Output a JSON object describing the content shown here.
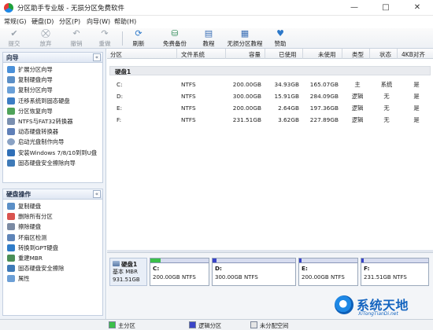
{
  "window": {
    "title": "分区助手专业版 - 无损分区免费软件",
    "controls": [
      "—",
      "□",
      "✕"
    ]
  },
  "menu": [
    "常规(G)",
    "硬盘(D)",
    "分区(P)",
    "向导(W)",
    "帮助(H)"
  ],
  "toolbar": {
    "buttons": [
      {
        "label": "提交",
        "icon": "checkmark-icon",
        "enabled": false
      },
      {
        "label": "放弃",
        "icon": "discard-icon",
        "enabled": false
      },
      {
        "label": "撤销",
        "icon": "undo-icon",
        "enabled": false
      },
      {
        "label": "重做",
        "icon": "redo-icon",
        "enabled": false
      },
      {
        "label": "刷新",
        "icon": "refresh-icon",
        "enabled": true
      },
      {
        "label": "免费备份",
        "icon": "backup-icon",
        "enabled": true
      },
      {
        "label": "教程",
        "icon": "book-icon",
        "enabled": true
      },
      {
        "label": "无损分区教程",
        "icon": "tutorial-icon",
        "enabled": true
      },
      {
        "label": "赞助",
        "icon": "heart-icon",
        "enabled": true
      }
    ]
  },
  "sidebar": {
    "wizard": {
      "title": "向导",
      "collapse": "«",
      "items": [
        "扩展分区向导",
        "复制硬盘向导",
        "复制分区向导",
        "迁移系统到固态硬盘",
        "分区恢复向导",
        "NTFS与FAT32转换器",
        "动态硬盘转换器",
        "启动光盘制作向导",
        "安装Windows 7/8/10到到U盘",
        "固态硬盘安全擦除向导"
      ]
    },
    "disk_ops": {
      "title": "硬盘操作",
      "collapse": "«",
      "items": [
        "复制硬盘",
        "删除所有分区",
        "擦除硬盘",
        "坏扇区检测",
        "转换到GPT硬盘",
        "重建MBR",
        "固态硬盘安全擦除",
        "属性"
      ]
    }
  },
  "table": {
    "columns": [
      "分区",
      "文件系统",
      "容量",
      "已使用",
      "未使用",
      "类型",
      "状态",
      "4KB对齐"
    ],
    "disk_label": "硬盘1",
    "rows": [
      {
        "partition": "C:",
        "fs": "NTFS",
        "capacity": "200.00GB",
        "used": "34.93GB",
        "free": "165.07GB",
        "type": "主",
        "status": "系统",
        "aligned": "是"
      },
      {
        "partition": "D:",
        "fs": "NTFS",
        "capacity": "300.00GB",
        "used": "15.91GB",
        "free": "284.09GB",
        "type": "逻辑",
        "status": "无",
        "aligned": "是"
      },
      {
        "partition": "E:",
        "fs": "NTFS",
        "capacity": "200.00GB",
        "used": "2.64GB",
        "free": "197.36GB",
        "type": "逻辑",
        "status": "无",
        "aligned": "是"
      },
      {
        "partition": "F:",
        "fs": "NTFS",
        "capacity": "231.51GB",
        "used": "3.62GB",
        "free": "227.89GB",
        "type": "逻辑",
        "status": "无",
        "aligned": "是"
      }
    ]
  },
  "disk_map": {
    "disk": {
      "name": "硬盘1",
      "type": "基本 MBR",
      "size": "931.51GB"
    },
    "partitions": [
      {
        "name": "C:",
        "info": "200.00GB NTFS",
        "used_fraction": 0.17,
        "color": "#3bbf4a"
      },
      {
        "name": "D:",
        "info": "300.00GB NTFS",
        "used_fraction": 0.05,
        "color": "#3a45c8"
      },
      {
        "name": "E:",
        "info": "200.00GB NTFS",
        "used_fraction": 0.02,
        "color": "#3a45c8"
      },
      {
        "name": "F:",
        "info": "231.51GB NTFS",
        "used_fraction": 0.02,
        "color": "#3a45c8"
      }
    ]
  },
  "status": {
    "legend": [
      {
        "label": "主分区",
        "color": "#3bbf4a"
      },
      {
        "label": "逻辑分区",
        "color": "#3a45c8"
      },
      {
        "label": "未分配空间",
        "color": "#e6e6e6"
      }
    ]
  },
  "watermark": {
    "big": "系统天地",
    "small": "XiTongTianDi.net"
  },
  "colors": {
    "accent": "#1e6fc8",
    "primary_partition": "#3bbf4a",
    "logical_partition": "#3a45c8"
  }
}
